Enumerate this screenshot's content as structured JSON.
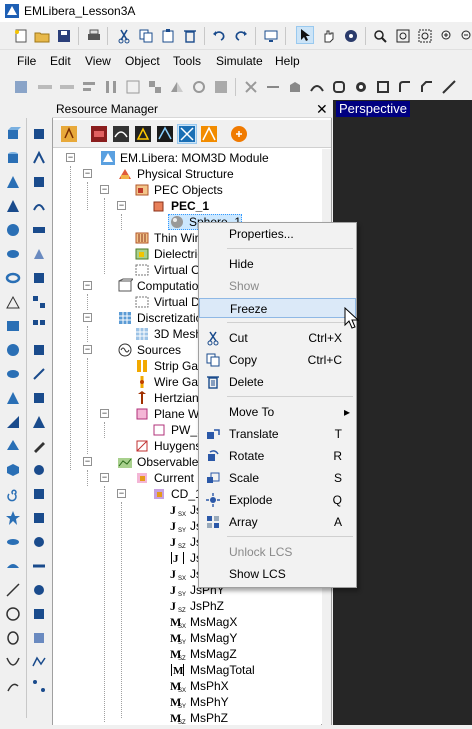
{
  "window": {
    "title": "EMLibera_Lesson3A"
  },
  "menu": [
    "File",
    "Edit",
    "View",
    "Object",
    "Tools",
    "Simulate",
    "Help"
  ],
  "resource_manager": {
    "title": "Resource Manager",
    "close": "✕"
  },
  "viewport": {
    "label": "Perspective"
  },
  "tree": [
    {
      "label": "EM.Libera: MOM3D Module"
    },
    {
      "label": "Physical Structure"
    },
    {
      "label": "PEC Objects"
    },
    {
      "label": "PEC_1"
    },
    {
      "label": "Sphere_1"
    },
    {
      "label": "Thin Wires"
    },
    {
      "label": "Dielectric Obj"
    },
    {
      "label": "Virtual Objec"
    },
    {
      "label": "Computational Do"
    },
    {
      "label": "Virtual Doma"
    },
    {
      "label": "Discretization"
    },
    {
      "label": "3D Mesh"
    },
    {
      "label": "Sources"
    },
    {
      "label": "Strip Gap Circ"
    },
    {
      "label": "Wire Gap Circ"
    },
    {
      "label": "Hertzian Sho"
    },
    {
      "label": "Plane Waves"
    },
    {
      "label": "PW_1"
    },
    {
      "label": "Huygens Sou"
    },
    {
      "label": "Observables"
    },
    {
      "label": "Current Distri"
    },
    {
      "label": "CD_1"
    },
    {
      "label": "JsMa"
    },
    {
      "label": "JsMa"
    },
    {
      "label": "JsMa"
    },
    {
      "label": "JsMa"
    },
    {
      "label": "JsPh"
    },
    {
      "label": "JsPhY"
    },
    {
      "label": "JsPhZ"
    },
    {
      "label": "MsMagX"
    },
    {
      "label": "MsMagY"
    },
    {
      "label": "MsMagZ"
    },
    {
      "label": "MsMagTotal"
    },
    {
      "label": "MsPhX"
    },
    {
      "label": "MsPhY"
    },
    {
      "label": "MsPhZ"
    }
  ],
  "context_menu": {
    "properties": "Properties...",
    "hide": "Hide",
    "show": "Show",
    "freeze": "Freeze",
    "cut": "Cut",
    "cut_sc": "Ctrl+X",
    "copy": "Copy",
    "copy_sc": "Ctrl+C",
    "delete": "Delete",
    "move_to": "Move To",
    "translate": "Translate",
    "translate_sc": "T",
    "rotate": "Rotate",
    "rotate_sc": "R",
    "scale": "Scale",
    "scale_sc": "S",
    "explode": "Explode",
    "explode_sc": "Q",
    "array": "Array",
    "array_sc": "A",
    "unlock_lcs": "Unlock LCS",
    "show_lcs": "Show LCS"
  },
  "colors": {
    "accent": "#000080",
    "viewport_bg": "#262626",
    "selection": "#cce8ff"
  }
}
